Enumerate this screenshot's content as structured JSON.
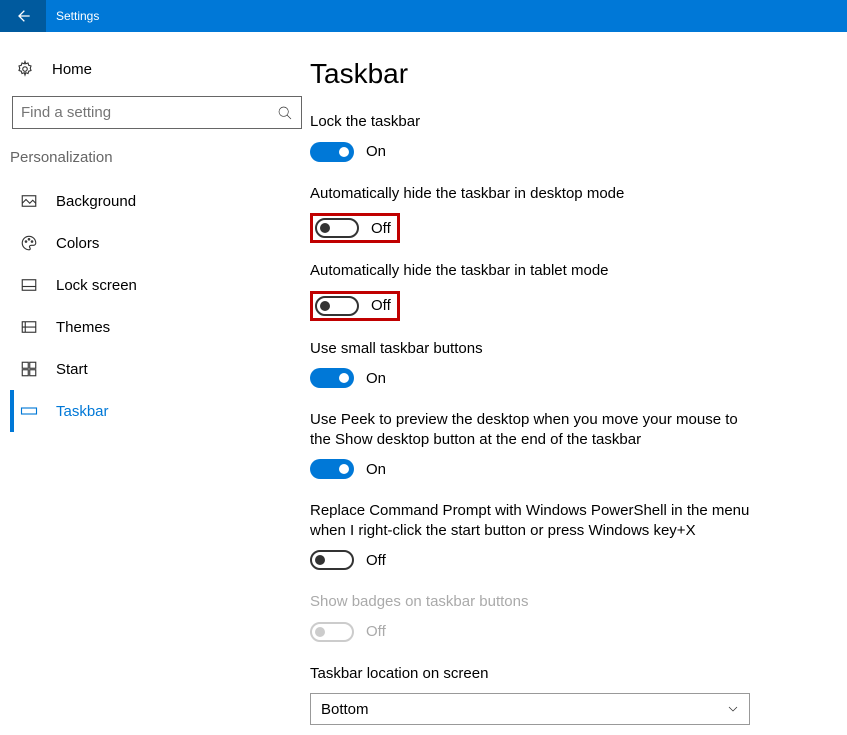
{
  "titlebar": {
    "title": "Settings"
  },
  "sidebar": {
    "home": "Home",
    "search_placeholder": "Find a setting",
    "section": "Personalization",
    "items": [
      {
        "label": "Background"
      },
      {
        "label": "Colors"
      },
      {
        "label": "Lock screen"
      },
      {
        "label": "Themes"
      },
      {
        "label": "Start"
      },
      {
        "label": "Taskbar"
      }
    ]
  },
  "main": {
    "heading": "Taskbar",
    "settings": [
      {
        "label": "Lock the taskbar",
        "state": "On"
      },
      {
        "label": "Automatically hide the taskbar in desktop mode",
        "state": "Off"
      },
      {
        "label": "Automatically hide the taskbar in tablet mode",
        "state": "Off"
      },
      {
        "label": "Use small taskbar buttons",
        "state": "On"
      },
      {
        "label": "Use Peek to preview the desktop when you move your mouse to the Show desktop button at the end of the taskbar",
        "state": "On"
      },
      {
        "label": "Replace Command Prompt with Windows PowerShell in the menu when I right-click the start button or press Windows key+X",
        "state": "Off"
      },
      {
        "label": "Show badges on taskbar buttons",
        "state": "Off"
      }
    ],
    "location": {
      "label": "Taskbar location on screen",
      "value": "Bottom"
    }
  }
}
